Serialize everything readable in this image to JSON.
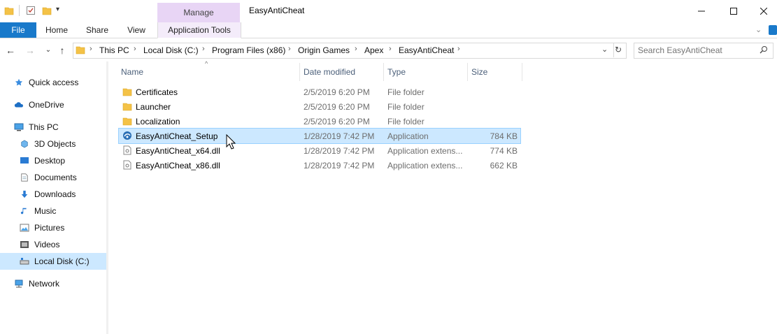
{
  "window": {
    "title": "EasyAntiCheat",
    "contextual_tab_group": "Manage"
  },
  "ribbon": {
    "tabs": [
      "File",
      "Home",
      "Share",
      "View",
      "Application Tools"
    ]
  },
  "address": {
    "crumbs": [
      "This PC",
      "Local Disk (C:)",
      "Program Files (x86)",
      "Origin Games",
      "Apex",
      "EasyAntiCheat"
    ]
  },
  "search": {
    "placeholder": "Search EasyAntiCheat"
  },
  "sidebar": {
    "items": [
      {
        "label": "Quick access",
        "icon": "star-icon"
      },
      {
        "label": "OneDrive",
        "icon": "cloud-icon"
      },
      {
        "label": "This PC",
        "icon": "computer-icon"
      },
      {
        "label": "3D Objects",
        "icon": "cube-icon"
      },
      {
        "label": "Desktop",
        "icon": "desktop-icon"
      },
      {
        "label": "Documents",
        "icon": "document-icon"
      },
      {
        "label": "Downloads",
        "icon": "download-icon"
      },
      {
        "label": "Music",
        "icon": "music-icon"
      },
      {
        "label": "Pictures",
        "icon": "picture-icon"
      },
      {
        "label": "Videos",
        "icon": "video-icon"
      },
      {
        "label": "Local Disk (C:)",
        "icon": "drive-icon"
      },
      {
        "label": "Network",
        "icon": "network-icon"
      }
    ],
    "selected": "Local Disk (C:)"
  },
  "columns": {
    "name": "Name",
    "date": "Date modified",
    "type": "Type",
    "size": "Size"
  },
  "files": [
    {
      "name": "Certificates",
      "date": "2/5/2019 6:20 PM",
      "type": "File folder",
      "size": "",
      "icon": "folder-icon"
    },
    {
      "name": "Launcher",
      "date": "2/5/2019 6:20 PM",
      "type": "File folder",
      "size": "",
      "icon": "folder-icon"
    },
    {
      "name": "Localization",
      "date": "2/5/2019 6:20 PM",
      "type": "File folder",
      "size": "",
      "icon": "folder-icon"
    },
    {
      "name": "EasyAntiCheat_Setup",
      "date": "1/28/2019 7:42 PM",
      "type": "Application",
      "size": "784 KB",
      "icon": "application-icon"
    },
    {
      "name": "EasyAntiCheat_x64.dll",
      "date": "1/28/2019 7:42 PM",
      "type": "Application extens...",
      "size": "774 KB",
      "icon": "dll-file-icon"
    },
    {
      "name": "EasyAntiCheat_x86.dll",
      "date": "1/28/2019 7:42 PM",
      "type": "Application extens...",
      "size": "662 KB",
      "icon": "dll-file-icon"
    }
  ],
  "selected_file": "EasyAntiCheat_Setup",
  "colors": {
    "accent": "#1979ca",
    "selection": "#cce8ff",
    "manage_tab": "#e8d5f5",
    "folder": "#f4c247"
  }
}
